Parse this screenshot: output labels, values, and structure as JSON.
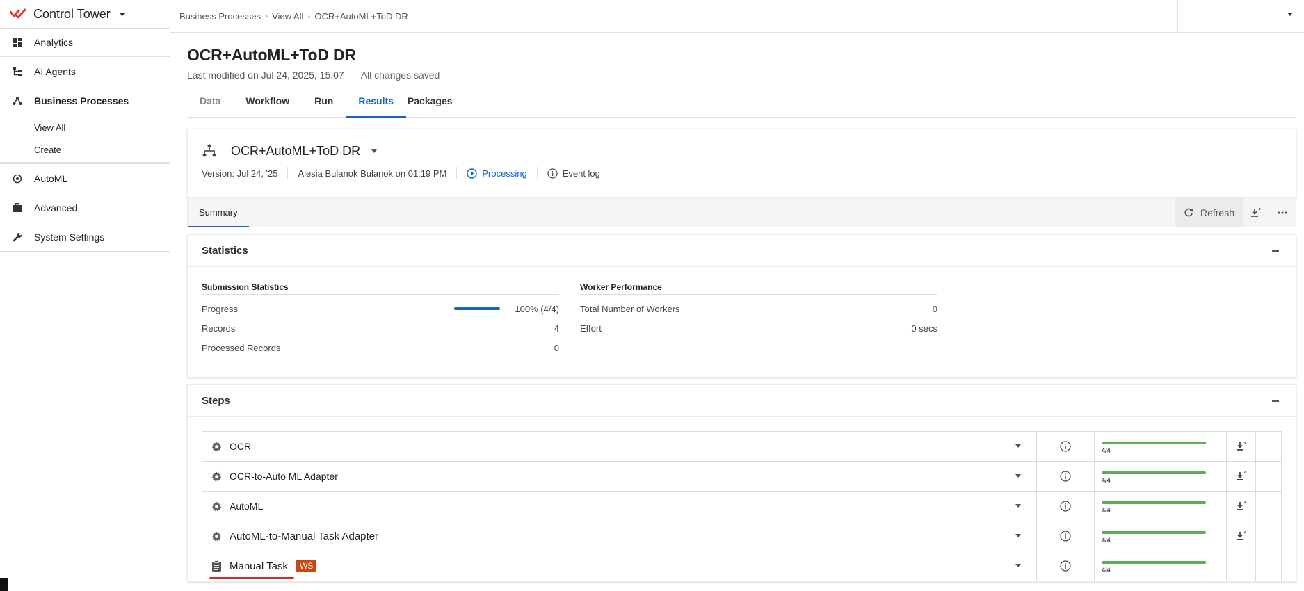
{
  "app": {
    "brand_name": "Control Tower",
    "accent_color": "#1565c0",
    "brand_color": "#e53935"
  },
  "sidebar": {
    "items": [
      {
        "label": "Analytics",
        "icon": "dashboard-icon"
      },
      {
        "label": "AI Agents",
        "icon": "hierarchy-icon"
      },
      {
        "label": "Business Processes",
        "icon": "process-icon"
      },
      {
        "label": "AutoML",
        "icon": "automl-icon"
      },
      {
        "label": "Advanced",
        "icon": "briefcase-icon"
      },
      {
        "label": "System Settings",
        "icon": "wrench-icon"
      }
    ],
    "sub_items": [
      {
        "label": "View All"
      },
      {
        "label": "Create"
      }
    ]
  },
  "breadcrumb": {
    "items": [
      "Business Processes",
      "View All",
      "OCR+AutoML+ToD DR"
    ]
  },
  "page": {
    "title": "OCR+AutoML+ToD DR",
    "last_modified": "Last modified on Jul 24, 2025, 15:07",
    "save_status": "All changes saved",
    "tabs": [
      {
        "label": "Data"
      },
      {
        "label": "Workflow"
      },
      {
        "label": "Run"
      },
      {
        "label": "Results"
      },
      {
        "label": "Packages"
      }
    ]
  },
  "process": {
    "name": "OCR+AutoML+ToD DR",
    "version": "Version: Jul 24, '25",
    "author": "Alesia Bulanok Bulanok on 01:19 PM",
    "status": "Processing",
    "event_log": "Event log"
  },
  "summary": {
    "tab_label": "Summary",
    "refresh_label": "Refresh"
  },
  "statistics": {
    "title": "Statistics",
    "submission": {
      "title": "Submission Statistics",
      "progress_label": "Progress",
      "progress_value": "100% (4/4)",
      "progress_fraction": 1.0,
      "records_label": "Records",
      "records_value": "4",
      "processed_label": "Processed Records",
      "processed_value": "0"
    },
    "worker": {
      "title": "Worker Performance",
      "workers_label": "Total Number of Workers",
      "workers_value": "0",
      "effort_label": "Effort",
      "effort_value": "0 secs"
    }
  },
  "steps": {
    "title": "Steps",
    "rows": [
      {
        "name": "OCR",
        "icon": "gear-icon",
        "count": "4/4",
        "progress": 1.0
      },
      {
        "name": "OCR-to-Auto ML Adapter",
        "icon": "gear-icon",
        "count": "4/4",
        "progress": 1.0
      },
      {
        "name": "AutoML",
        "icon": "gear-icon",
        "count": "4/4",
        "progress": 1.0
      },
      {
        "name": "AutoML-to-Manual Task Adapter",
        "icon": "gear-icon",
        "count": "4/4",
        "progress": 1.0
      },
      {
        "name": "Manual Task",
        "icon": "clipboard-icon",
        "badge": "WS",
        "count": "4/4",
        "progress": 1.0
      }
    ]
  }
}
